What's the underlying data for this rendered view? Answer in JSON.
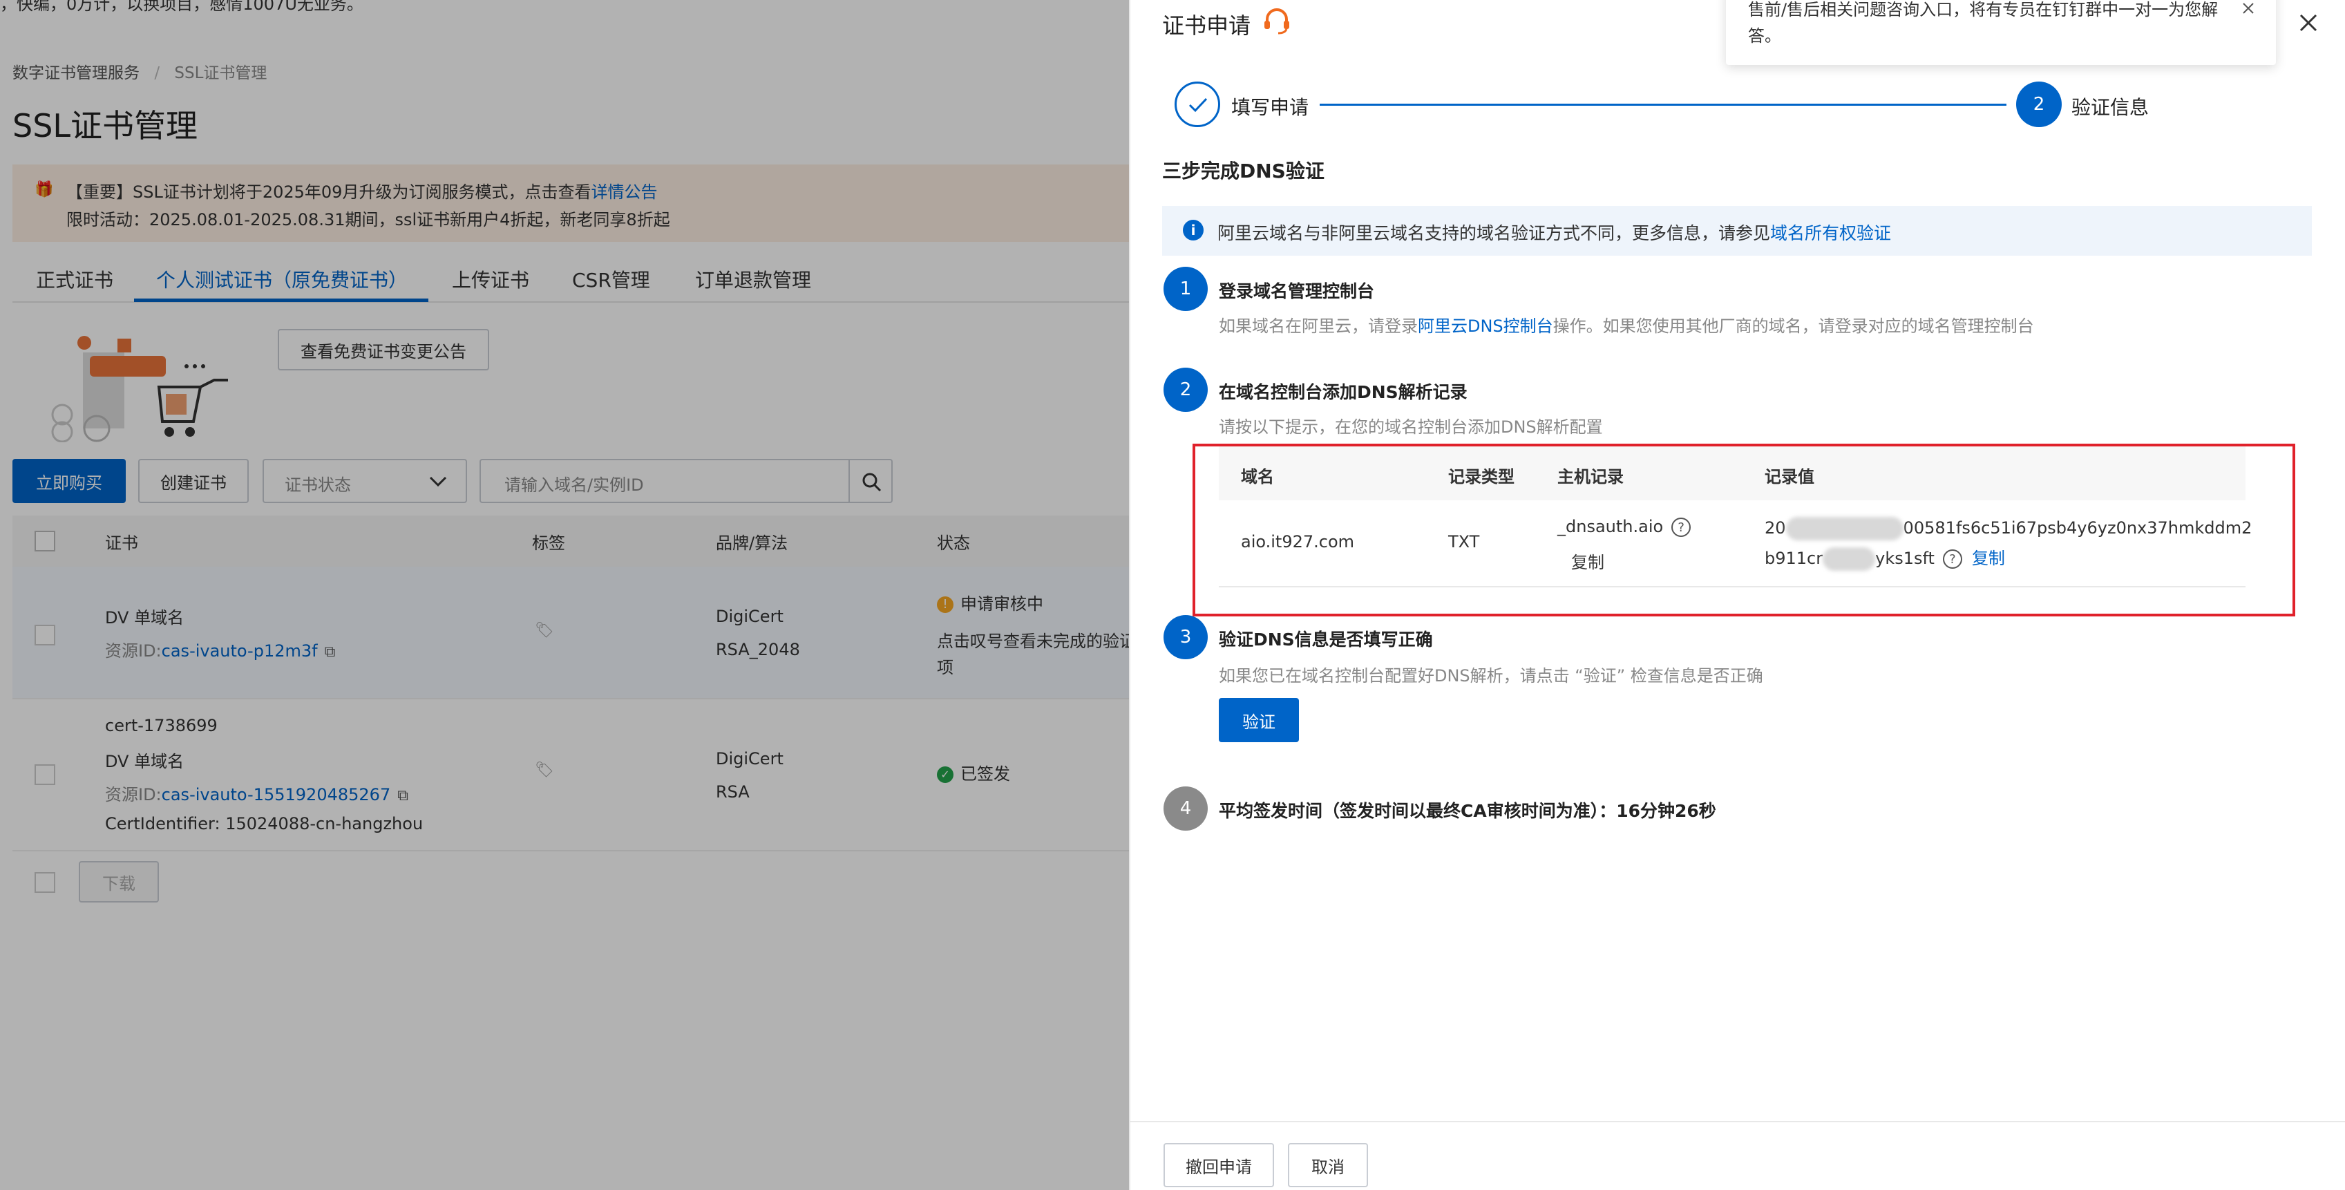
{
  "bg": {
    "top_banner": "，快编，0万计，以换项目，感情1007U无业务。",
    "breadcrumb": [
      "数字证书管理服务",
      "SSL证书管理"
    ],
    "breadcrumb_sep": "/",
    "page_title": "SSL证书管理",
    "notice_line1_prefix": "【重要】SSL证书计划将于2025年09月升级为订阅服务模式，点击查看",
    "notice_line1_link": "详情公告",
    "notice_line2": "限时活动：2025.08.01-2025.08.31期间，ssl证书新用户4折起，新老同享8折起",
    "tabs": [
      "正式证书",
      "个人测试证书（原免费证书）",
      "上传证书",
      "CSR管理",
      "订单退款管理"
    ],
    "announce_button": "查看免费证书变更公告",
    "buy_button": "立即购买",
    "create_button": "创建证书",
    "status_select": "证书状态",
    "search_placeholder": "请输入域名/实例ID",
    "table_headers": [
      "证书",
      "标签",
      "品牌/算法",
      "状态"
    ],
    "rows": [
      {
        "type": "DV 单域名",
        "res_label": "资源ID:",
        "res_id": "cas-ivauto-p12m3f",
        "brand": "DigiCert",
        "algo": "RSA_2048",
        "status": "申请审核中",
        "status_note_1": "点击叹号查看未完成的验证",
        "status_note_2": "项"
      },
      {
        "name": "cert-1738699",
        "type": "DV 单域名",
        "res_label": "资源ID:",
        "res_id": "cas-ivauto-1551920485267",
        "identifier": "CertIdentifier: 15024088-cn-hangzhou",
        "brand": "DigiCert",
        "algo": "RSA",
        "status": "已签发"
      }
    ],
    "download_button": "下载",
    "colors": {
      "primary": "#0064c8",
      "warning": "#f5a623",
      "success": "#23a34b"
    }
  },
  "drawer": {
    "title": "证书申请",
    "tooltip_text_1": "售前/售后相关问题咨询入口，将有专员在钉钉群中一对一为您解",
    "tooltip_text_2": "答。",
    "steps": [
      {
        "label": "填写申请",
        "done": true
      },
      {
        "label": "验证信息",
        "number": "2"
      }
    ],
    "section_title": "三步完成DNS验证",
    "info_prefix": "阿里云域名与非阿里云域名支持的域名验证方式不同，更多信息，请参见",
    "info_link": "域名所有权验证",
    "step1_num": "1",
    "step1_title": "登录域名管理控制台",
    "step1_desc_prefix": "如果域名在阿里云，请登录",
    "step1_desc_link": "阿里云DNS控制台",
    "step1_desc_suffix": "操作。如果您使用其他厂商的域名，请登录对应的域名管理控制台",
    "step2_num": "2",
    "step2_title": "在域名控制台添加DNS解析记录",
    "step2_desc": "请按以下提示，在您的域名控制台添加DNS解析配置",
    "table_headers": [
      "域名",
      "记录类型",
      "主机记录",
      "记录值"
    ],
    "record": {
      "domain": "aio.it927.com",
      "type": "TXT",
      "host": "_dnsauth.aio",
      "copy": "复制",
      "value_l1_start": "20",
      "value_l1_end": "00581fs6c51i67psb4y6yz0nx37hmkddm2",
      "value_l2_start": "b911cr",
      "value_l2_end": "yks1sft"
    },
    "step3_num": "3",
    "step3_title": "验证DNS信息是否填写正确",
    "step3_desc": "如果您已在域名控制台配置好DNS解析，请点击 “验证” 检查信息是否正确",
    "verify_button": "验证",
    "step4_num": "4",
    "step4_title": "平均签发时间（签发时间以最终CA审核时间为准）：16分钟26秒",
    "footer_withdraw": "撤回申请",
    "footer_cancel": "取消",
    "colors": {
      "highlight_box": "#e0212b",
      "info_bg": "#eef4fb"
    }
  }
}
